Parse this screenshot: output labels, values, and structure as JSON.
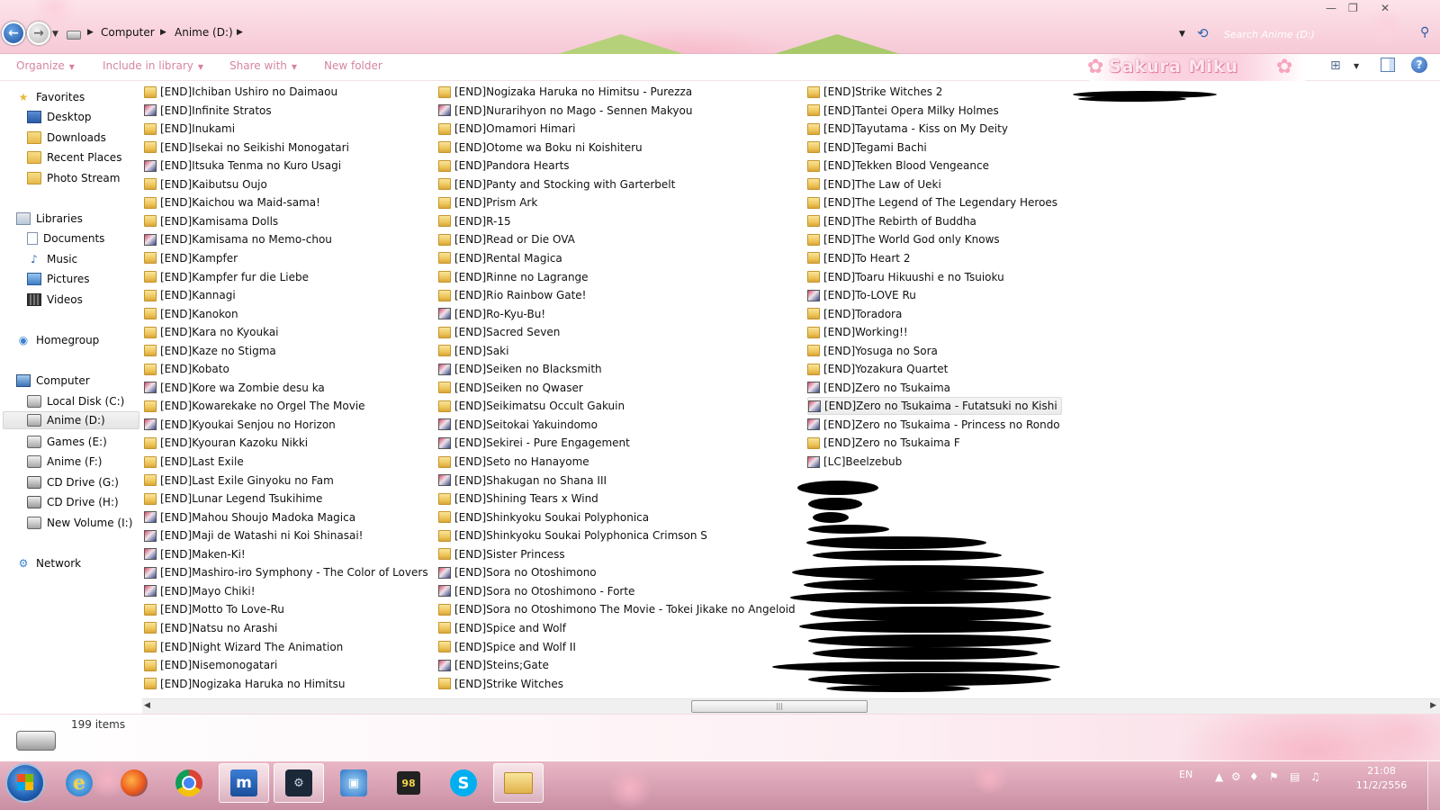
{
  "window": {
    "controls": {
      "minimize": "—",
      "maximize": "❐",
      "close": "✕"
    }
  },
  "address": {
    "crumbs": [
      "Computer",
      "Anime (D:)"
    ],
    "search_placeholder": "Search Anime (D:)"
  },
  "toolbar": {
    "organize": "Organize",
    "include_in_library": "Include in library",
    "share_with": "Share with",
    "new_folder": "New folder",
    "brand": "Sakura Miku"
  },
  "nav": {
    "favorites": [
      "Favorites",
      "Desktop",
      "Downloads",
      "Recent Places",
      "Photo Stream"
    ],
    "libraries": [
      "Libraries",
      "Documents",
      "Music",
      "Pictures",
      "Videos"
    ],
    "homegroup": "Homegroup",
    "computer": [
      "Computer",
      "Local Disk (C:)",
      "Anime (D:)",
      "Games (E:)",
      "Anime (F:)",
      "CD Drive (G:)",
      "CD Drive (H:)",
      "New Volume (I:)"
    ],
    "network": "Network",
    "selected": "Anime (D:)"
  },
  "files": {
    "col1": [
      {
        "name": "[END]Ichiban Ushiro no Daimaou",
        "icon": "folder"
      },
      {
        "name": "[END]Infinite Stratos",
        "icon": "image"
      },
      {
        "name": "[END]Inukami",
        "icon": "folder"
      },
      {
        "name": "[END]Isekai no Seikishi Monogatari",
        "icon": "folder"
      },
      {
        "name": "[END]Itsuka Tenma no Kuro Usagi",
        "icon": "image"
      },
      {
        "name": "[END]Kaibutsu Oujo",
        "icon": "folder"
      },
      {
        "name": "[END]Kaichou wa Maid-sama!",
        "icon": "folder"
      },
      {
        "name": "[END]Kamisama Dolls",
        "icon": "folder"
      },
      {
        "name": "[END]Kamisama no Memo-chou",
        "icon": "image"
      },
      {
        "name": "[END]Kampfer",
        "icon": "folder"
      },
      {
        "name": "[END]Kampfer fur die Liebe",
        "icon": "folder"
      },
      {
        "name": "[END]Kannagi",
        "icon": "folder"
      },
      {
        "name": "[END]Kanokon",
        "icon": "folder"
      },
      {
        "name": "[END]Kara no Kyoukai",
        "icon": "folder"
      },
      {
        "name": "[END]Kaze no Stigma",
        "icon": "folder"
      },
      {
        "name": "[END]Kobato",
        "icon": "folder"
      },
      {
        "name": "[END]Kore wa Zombie desu ka",
        "icon": "image"
      },
      {
        "name": "[END]Kowarekake no Orgel The Movie",
        "icon": "folder"
      },
      {
        "name": "[END]Kyoukai Senjou no Horizon",
        "icon": "image"
      },
      {
        "name": "[END]Kyouran Kazoku Nikki",
        "icon": "folder"
      },
      {
        "name": "[END]Last Exile",
        "icon": "folder"
      },
      {
        "name": "[END]Last Exile Ginyoku no Fam",
        "icon": "folder"
      },
      {
        "name": "[END]Lunar Legend Tsukihime",
        "icon": "folder"
      },
      {
        "name": "[END]Mahou Shoujo Madoka Magica",
        "icon": "image"
      },
      {
        "name": "[END]Maji de Watashi ni Koi Shinasai!",
        "icon": "image"
      },
      {
        "name": "[END]Maken-Ki!",
        "icon": "image"
      },
      {
        "name": "[END]Mashiro-iro Symphony - The Color of Lovers",
        "icon": "image"
      },
      {
        "name": "[END]Mayo Chiki!",
        "icon": "image"
      },
      {
        "name": "[END]Motto To Love-Ru",
        "icon": "folder"
      },
      {
        "name": "[END]Natsu no Arashi",
        "icon": "folder"
      },
      {
        "name": "[END]Night Wizard The Animation",
        "icon": "folder"
      },
      {
        "name": "[END]Nisemonogatari",
        "icon": "folder"
      },
      {
        "name": "[END]Nogizaka Haruka no Himitsu",
        "icon": "folder"
      }
    ],
    "col2": [
      {
        "name": "[END]Nogizaka Haruka no Himitsu - Purezza",
        "icon": "folder"
      },
      {
        "name": "[END]Nurarihyon no Mago - Sennen Makyou",
        "icon": "image"
      },
      {
        "name": "[END]Omamori Himari",
        "icon": "folder"
      },
      {
        "name": "[END]Otome wa Boku ni Koishiteru",
        "icon": "folder"
      },
      {
        "name": "[END]Pandora Hearts",
        "icon": "folder"
      },
      {
        "name": "[END]Panty and Stocking with Garterbelt",
        "icon": "folder"
      },
      {
        "name": "[END]Prism Ark",
        "icon": "folder"
      },
      {
        "name": "[END]R-15",
        "icon": "folder"
      },
      {
        "name": "[END]Read or Die OVA",
        "icon": "folder"
      },
      {
        "name": "[END]Rental Magica",
        "icon": "folder"
      },
      {
        "name": "[END]Rinne no Lagrange",
        "icon": "folder"
      },
      {
        "name": "[END]Rio Rainbow Gate!",
        "icon": "folder"
      },
      {
        "name": "[END]Ro-Kyu-Bu!",
        "icon": "image"
      },
      {
        "name": "[END]Sacred Seven",
        "icon": "folder"
      },
      {
        "name": "[END]Saki",
        "icon": "folder"
      },
      {
        "name": "[END]Seiken no Blacksmith",
        "icon": "image"
      },
      {
        "name": "[END]Seiken no Qwaser",
        "icon": "folder"
      },
      {
        "name": "[END]Seikimatsu Occult Gakuin",
        "icon": "folder"
      },
      {
        "name": "[END]Seitokai Yakuindomo",
        "icon": "image"
      },
      {
        "name": "[END]Sekirei - Pure Engagement",
        "icon": "image"
      },
      {
        "name": "[END]Seto no Hanayome",
        "icon": "folder"
      },
      {
        "name": "[END]Shakugan no Shana III",
        "icon": "image"
      },
      {
        "name": "[END]Shining Tears x Wind",
        "icon": "folder"
      },
      {
        "name": "[END]Shinkyoku Soukai Polyphonica",
        "icon": "folder"
      },
      {
        "name": "[END]Shinkyoku Soukai Polyphonica Crimson S",
        "icon": "folder"
      },
      {
        "name": "[END]Sister Princess",
        "icon": "folder"
      },
      {
        "name": "[END]Sora no Otoshimono",
        "icon": "image"
      },
      {
        "name": "[END]Sora no Otoshimono - Forte",
        "icon": "image"
      },
      {
        "name": "[END]Sora no Otoshimono The Movie - Tokei Jikake no Angeloid",
        "icon": "folder"
      },
      {
        "name": "[END]Spice and Wolf",
        "icon": "folder"
      },
      {
        "name": "[END]Spice and Wolf II",
        "icon": "folder"
      },
      {
        "name": "[END]Steins;Gate",
        "icon": "image"
      },
      {
        "name": "[END]Strike Witches",
        "icon": "folder"
      }
    ],
    "col3": [
      {
        "name": "[END]Strike Witches 2",
        "icon": "folder"
      },
      {
        "name": "[END]Tantei Opera Milky Holmes",
        "icon": "folder"
      },
      {
        "name": "[END]Tayutama - Kiss on My Deity",
        "icon": "folder"
      },
      {
        "name": "[END]Tegami Bachi",
        "icon": "folder"
      },
      {
        "name": "[END]Tekken Blood Vengeance",
        "icon": "folder"
      },
      {
        "name": "[END]The Law of Ueki",
        "icon": "folder"
      },
      {
        "name": "[END]The Legend of The Legendary Heroes",
        "icon": "folder"
      },
      {
        "name": "[END]The Rebirth of Buddha",
        "icon": "folder"
      },
      {
        "name": "[END]The World God only Knows",
        "icon": "folder"
      },
      {
        "name": "[END]To Heart 2",
        "icon": "folder"
      },
      {
        "name": "[END]Toaru Hikuushi e no Tsuioku",
        "icon": "folder"
      },
      {
        "name": "[END]To-LOVE Ru",
        "icon": "image"
      },
      {
        "name": "[END]Toradora",
        "icon": "folder"
      },
      {
        "name": "[END]Working!!",
        "icon": "folder"
      },
      {
        "name": "[END]Yosuga no Sora",
        "icon": "folder"
      },
      {
        "name": "[END]Yozakura Quartet",
        "icon": "folder"
      },
      {
        "name": "[END]Zero no Tsukaima",
        "icon": "image"
      },
      {
        "name": "[END]Zero no Tsukaima - Futatsuki no Kishi",
        "icon": "image"
      },
      {
        "name": "[END]Zero no Tsukaima - Princess no Rondo",
        "icon": "image"
      },
      {
        "name": "[END]Zero no Tsukaima F",
        "icon": "folder"
      },
      {
        "name": "[LC]Beelzebub",
        "icon": "image"
      }
    ],
    "hovered": "[END]Zero no Tsukaima - Futatsuki no Kishi"
  },
  "status": {
    "item_count": "199 items"
  },
  "taskbar": {
    "apps": [
      {
        "name": "internet-explorer",
        "glyph": "e"
      },
      {
        "name": "firefox",
        "glyph": ""
      },
      {
        "name": "chrome",
        "glyph": ""
      },
      {
        "name": "maxthon",
        "glyph": "m"
      },
      {
        "name": "steam",
        "glyph": "⚙"
      },
      {
        "name": "network-monitor",
        "glyph": "▣"
      },
      {
        "name": "cpu-meter",
        "glyph": "98"
      },
      {
        "name": "skype",
        "glyph": "S"
      },
      {
        "name": "windows-explorer",
        "glyph": ""
      }
    ],
    "language": "EN",
    "time": "21:08",
    "date": "11/2/2556"
  },
  "colors": {
    "toolbar_text": "#d6859e",
    "accent_pink": "#f6a5bd",
    "taskbar_pink": "#c98ea3"
  }
}
